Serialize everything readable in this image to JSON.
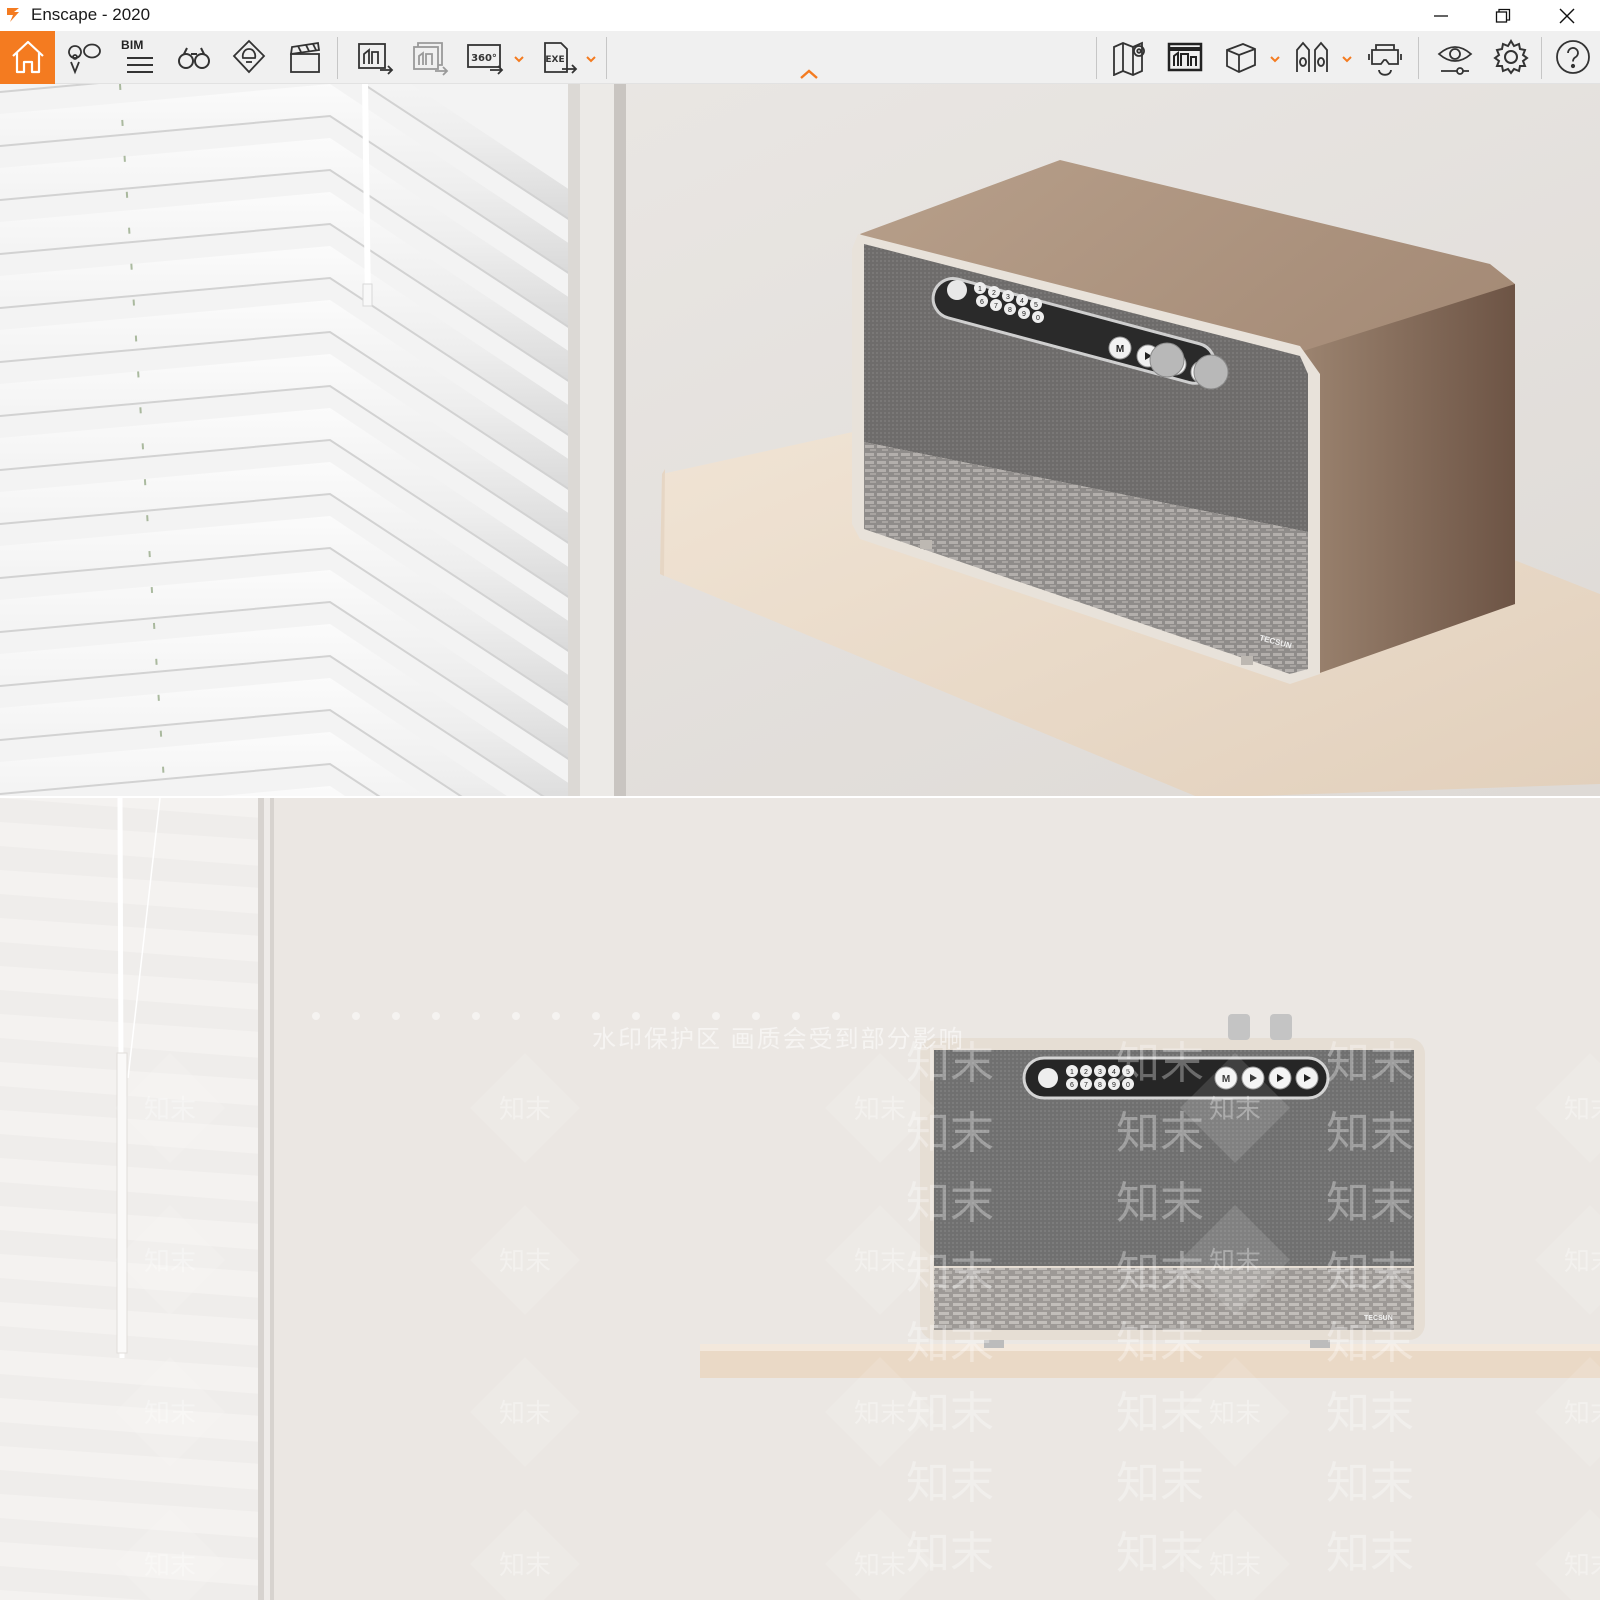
{
  "window": {
    "title": "Enscape - 2020",
    "logo_icon": "enscape-logo-icon",
    "controls": [
      "minimize-icon",
      "restore-icon",
      "close-icon"
    ]
  },
  "toolbar": {
    "accent_color": "#f47b20",
    "left_buttons": [
      "home-icon",
      "annotation-pin-icon",
      "bim-icon",
      "binoculars-icon",
      "light-view-icon",
      "video-editor-icon",
      "render-image-icon",
      "batch-render-icon",
      "panorama-360-icon",
      "export-exe-icon"
    ],
    "bim_label": "BIM",
    "panorama_label": "360°",
    "exe_label": "EXE",
    "right_buttons": [
      "map-icon",
      "asset-library-icon",
      "material-cube-icon",
      "sound-icon",
      "vr-headset-icon",
      "view-settings-icon",
      "settings-gear-icon",
      "help-icon"
    ]
  },
  "viewport": {
    "speaker_brand": "TECSUN",
    "preset_keys": [
      "1",
      "2",
      "3",
      "4",
      "5",
      "6",
      "7",
      "8",
      "9",
      "0"
    ],
    "mode_key": "M"
  },
  "second_render": {
    "speaker_brand": "TECSUN",
    "mode_key": "M",
    "watermark_banner": "水印保护区  画质会受到部分影响",
    "watermark_logo": "知末"
  }
}
